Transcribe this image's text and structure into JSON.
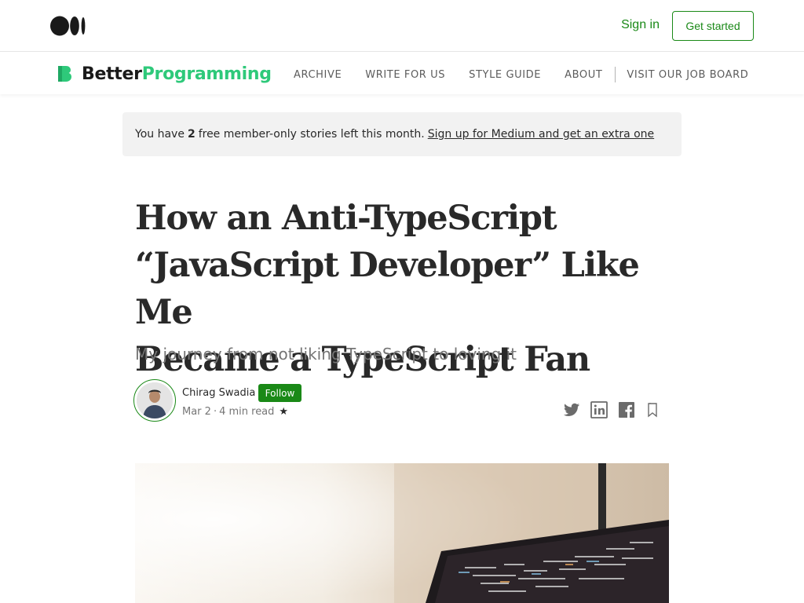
{
  "topbar": {
    "sign_in": "Sign in",
    "get_started": "Get started"
  },
  "publication": {
    "name_part1": "Better",
    "name_part2": "Programming",
    "nav": [
      "ARCHIVE",
      "WRITE FOR US",
      "STYLE GUIDE",
      "ABOUT",
      "VISIT OUR JOB BOARD"
    ]
  },
  "banner": {
    "prefix": "You have",
    "count": "2",
    "suffix": "free member-only stories left this month.",
    "link": "Sign up for Medium and get an extra one"
  },
  "article": {
    "title_line1": "How an Anti-TypeScript",
    "title_line2": "“JavaScript Developer” Like Me",
    "title_line3": "Became a TypeScript Fan",
    "subtitle": "My journey from not liking TypeScript to loving it"
  },
  "author": {
    "name": "Chirag Swadia",
    "follow_label": "Follow",
    "date": "Mar 2",
    "read_time": "4 min read",
    "star": "★"
  },
  "share_icons": [
    "twitter-icon",
    "linkedin-icon",
    "facebook-icon",
    "bookmark-icon"
  ],
  "colors": {
    "accent_green": "#1a8917",
    "brand_green": "#2ec97a",
    "banner_bg": "#f2f2f2"
  }
}
